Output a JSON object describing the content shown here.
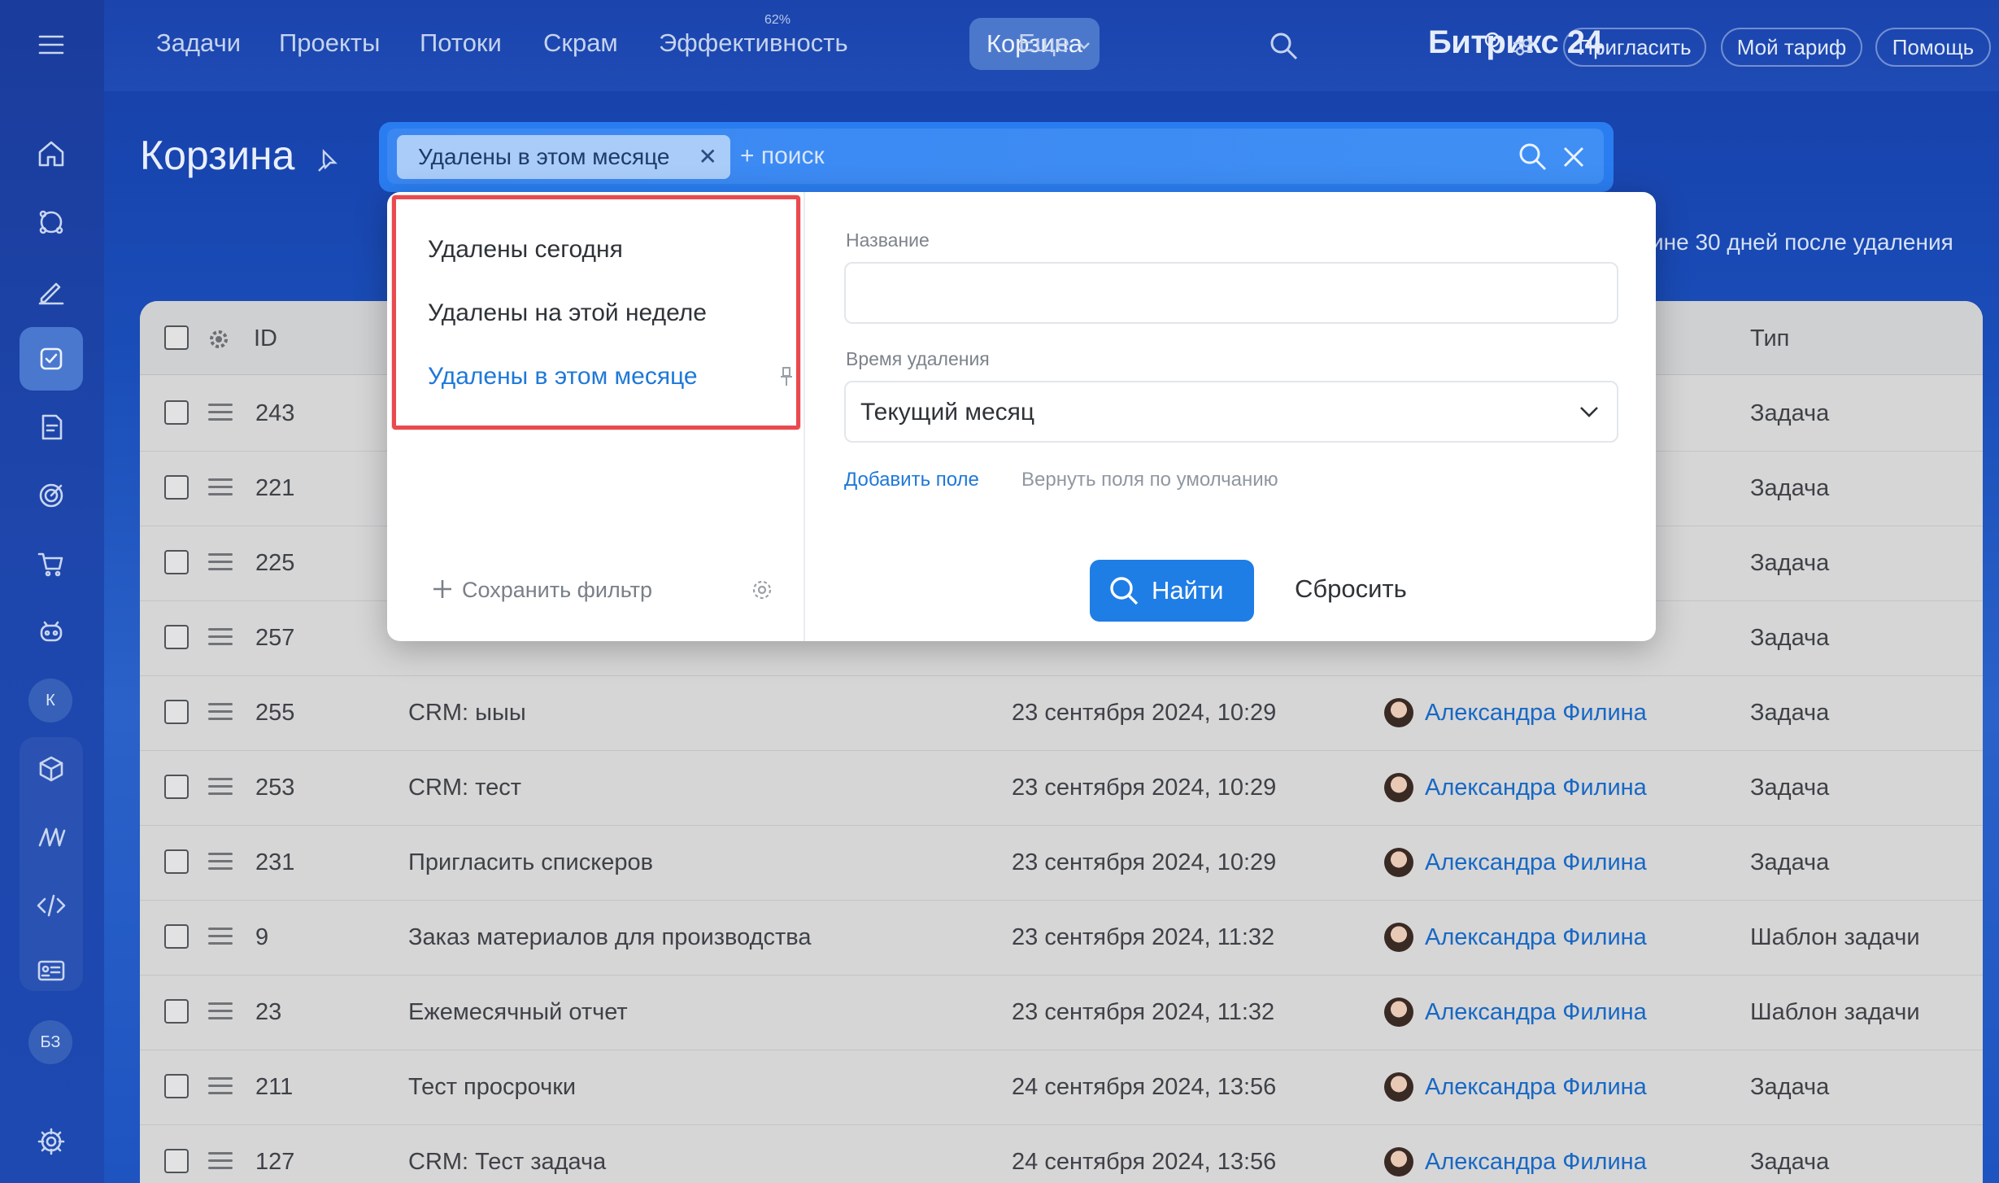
{
  "topnav": {
    "items": [
      "Задачи",
      "Проекты",
      "Потоки",
      "Скрам",
      "Эффективность",
      "Корзина",
      "Еще"
    ],
    "efficiency_badge": "62%",
    "brand": "Битрикс 24",
    "invite": "Пригласить",
    "tariff": "Мой тариф",
    "help": "Помощь"
  },
  "page": {
    "title": "Корзина",
    "note": "ине 30 дней после удаления"
  },
  "search": {
    "chip": "Удалены в этом месяце",
    "placeholder": "+ поиск"
  },
  "filter": {
    "presets": [
      "Удалены сегодня",
      "Удалены на этой неделе",
      "Удалены в этом месяце"
    ],
    "active_preset": "Удалены в этом месяце",
    "save_filter": "Сохранить фильтр",
    "name_label": "Название",
    "name_value": "",
    "time_label": "Время удаления",
    "time_value": "Текущий месяц",
    "add_field": "Добавить поле",
    "reset_fields": "Вернуть поля по умолчанию",
    "find": "Найти",
    "reset": "Сбросить"
  },
  "rail": {
    "letter_1": "К",
    "letter_2": "БЗ"
  },
  "table": {
    "headers": {
      "id": "ID",
      "type": "Тип"
    },
    "rows": [
      {
        "id": "243",
        "name": "",
        "date": "",
        "user": "",
        "type": "Задача"
      },
      {
        "id": "221",
        "name": "",
        "date": "",
        "user": "",
        "type": "Задача"
      },
      {
        "id": "225",
        "name": "",
        "date": "",
        "user": "",
        "type": "Задача"
      },
      {
        "id": "257",
        "name": "",
        "date": "",
        "user": "",
        "type": "Задача"
      },
      {
        "id": "255",
        "name": "CRM: ыыы",
        "date": "23 сентября 2024, 10:29",
        "user": "Александра Филина",
        "type": "Задача"
      },
      {
        "id": "253",
        "name": "CRM: тест",
        "date": "23 сентября 2024, 10:29",
        "user": "Александра Филина",
        "type": "Задача"
      },
      {
        "id": "231",
        "name": "Пригласить спискеров",
        "date": "23 сентября 2024, 10:29",
        "user": "Александра Филина",
        "type": "Задача"
      },
      {
        "id": "9",
        "name": "Заказ материалов для производства",
        "date": "23 сентября 2024, 11:32",
        "user": "Александра Филина",
        "type": "Шаблон задачи"
      },
      {
        "id": "23",
        "name": "Ежемесячный отчет",
        "date": "23 сентября 2024, 11:32",
        "user": "Александра Филина",
        "type": "Шаблон задачи"
      },
      {
        "id": "211",
        "name": "Тест просрочки",
        "date": "24 сентября 2024, 13:56",
        "user": "Александра Филина",
        "type": "Задача"
      },
      {
        "id": "127",
        "name": "CRM: Тест задача",
        "date": "24 сентября 2024, 13:56",
        "user": "Александра Филина",
        "type": "Задача"
      }
    ]
  },
  "colors": {
    "accent": "#1f7de6",
    "highlight_frame": "#e84a4f",
    "link": "#1768c4"
  }
}
